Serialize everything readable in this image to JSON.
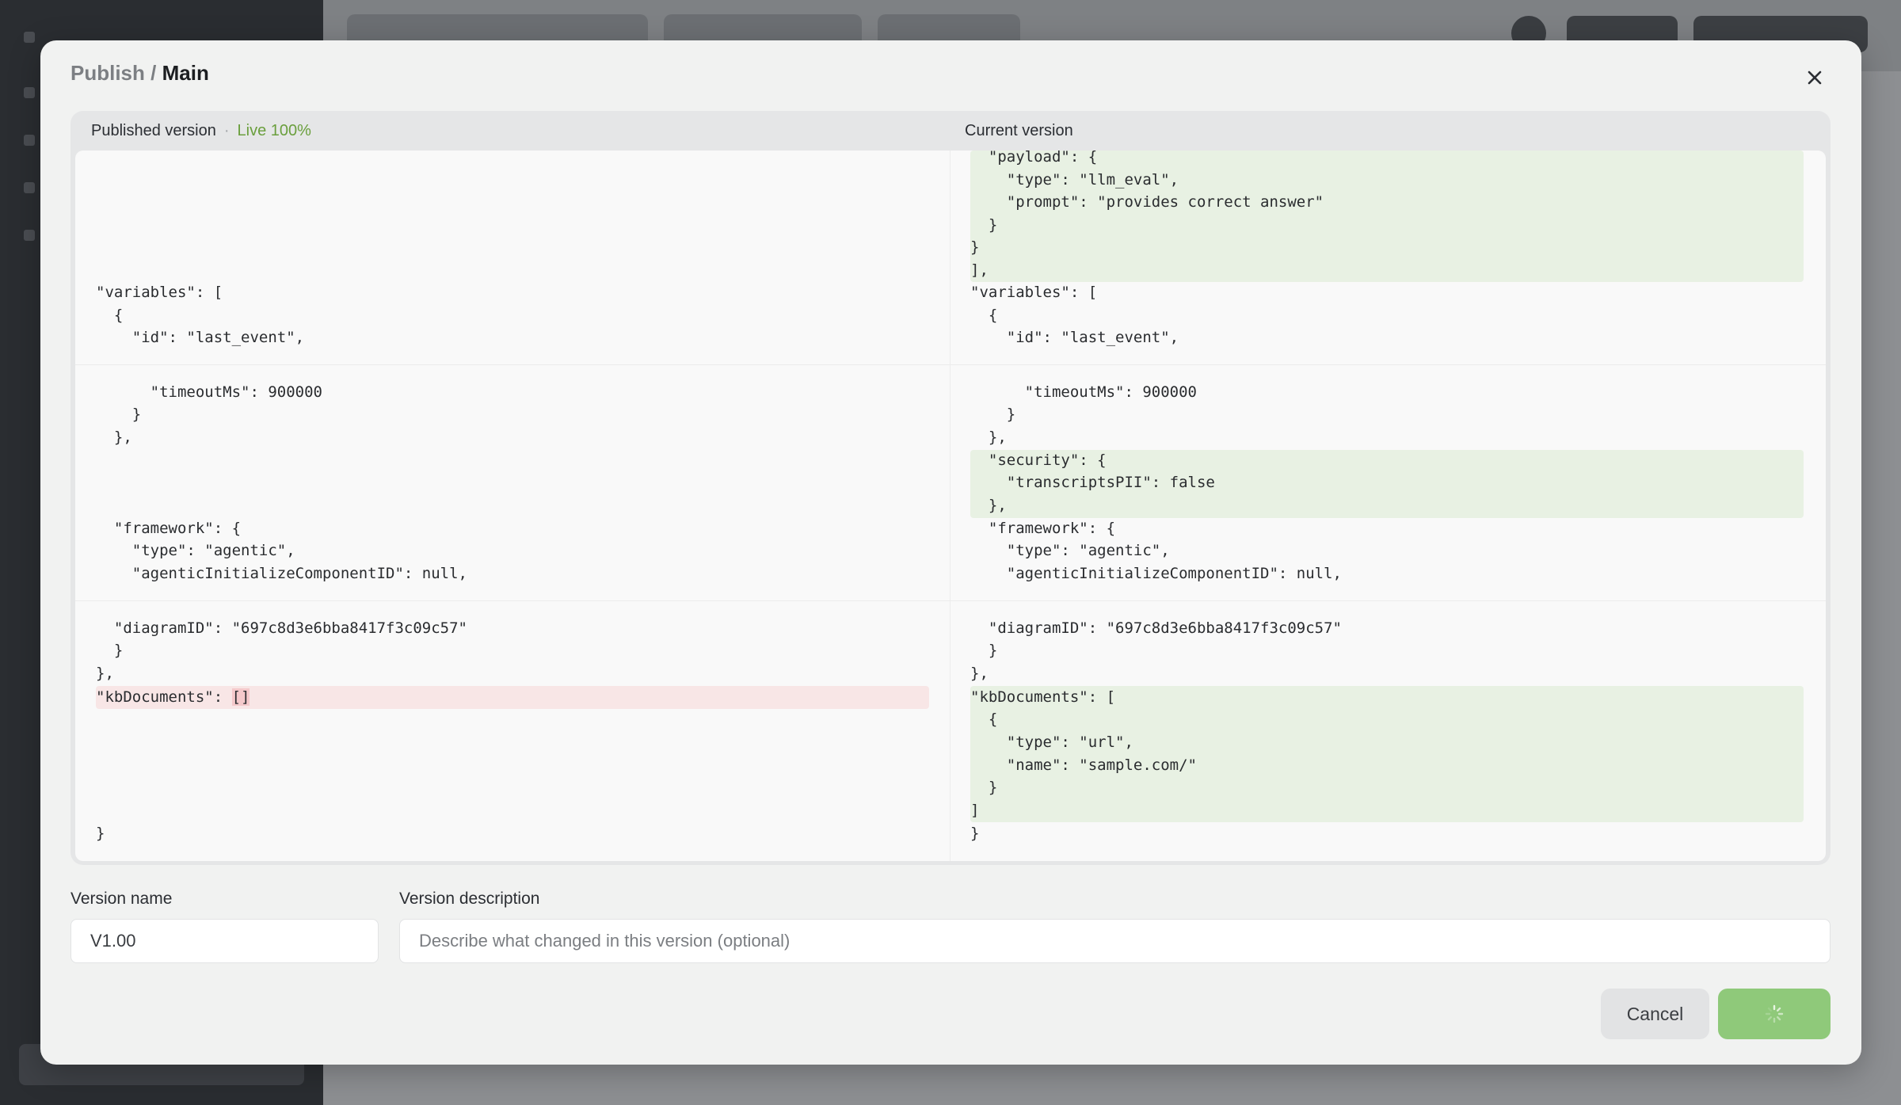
{
  "modal": {
    "title_section": "Publish",
    "title_separator": "/",
    "title_current": "Main"
  },
  "diff": {
    "left_header": "Published version",
    "left_header_dot": "·",
    "left_status": "Live 100%",
    "right_header": "Current version",
    "left_lines": [
      "\"variables\": [",
      "  {",
      "    \"id\": \"last_event\",",
      "      \"timeoutMs\": 900000",
      "    }",
      "  },",
      "  \"framework\": {",
      "    \"type\": \"agentic\",",
      "    \"agenticInitializeComponentID\": null,",
      "  \"diagramID\": \"697c8d3e6bba8417f3c09c57\"",
      "  }",
      "},",
      "\"kbDocuments\": ",
      "[]",
      "}"
    ],
    "right_lines": [
      "  \"payload\": {",
      "    \"type\": \"llm_eval\",",
      "    \"prompt\": \"provides correct answer\"",
      "  }",
      "}",
      "],",
      "\"variables\": [",
      "  {",
      "    \"id\": \"last_event\",",
      "      \"timeoutMs\": 900000",
      "    }",
      "  },",
      "  \"security\": {",
      "    \"transcriptsPII\": false",
      "  },",
      "  \"framework\": {",
      "    \"type\": \"agentic\",",
      "    \"agenticInitializeComponentID\": null,",
      "  \"diagramID\": \"697c8d3e6bba8417f3c09c57\"",
      "  }",
      "},",
      "\"kbDocuments\": [",
      "  {",
      "    \"type\": \"url\",",
      "    \"name\": \"sample.com/\"",
      "  }",
      "]",
      "}"
    ]
  },
  "form": {
    "version_name_label": "Version name",
    "version_name_value": "V1.00",
    "version_description_label": "Version description",
    "version_description_placeholder": "Describe what changed in this version (optional)"
  },
  "actions": {
    "cancel_label": "Cancel",
    "publish_state": "loading"
  },
  "colors": {
    "added_bg": "#e8f1e3",
    "removed_bg": "#f8e6e6",
    "live_green": "#6a9f3d",
    "publish_button": "#8fc97a"
  }
}
